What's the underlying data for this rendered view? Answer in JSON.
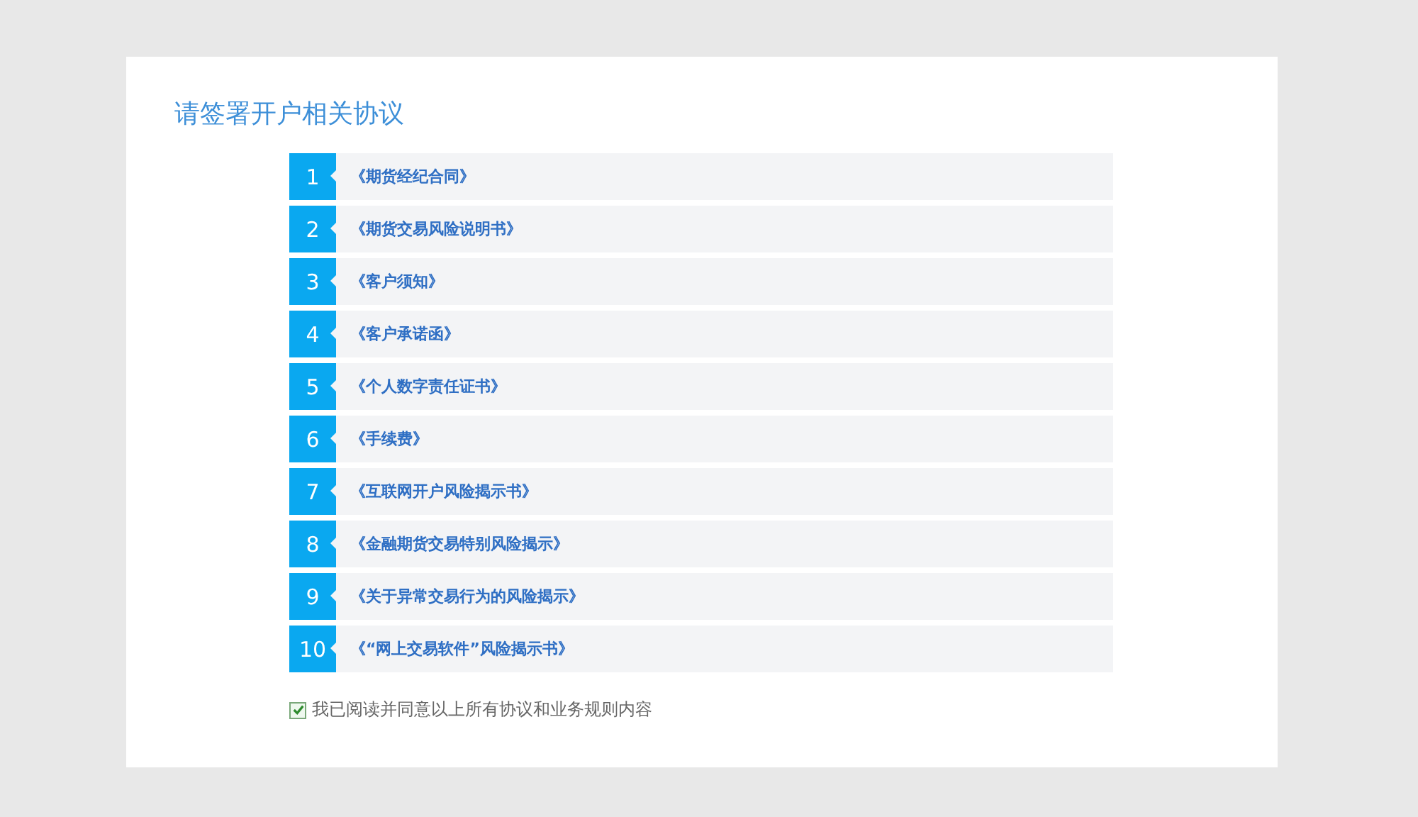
{
  "title": "请签署开户相关协议",
  "agreements": [
    {
      "number": "1",
      "name": "《期货经纪合同》"
    },
    {
      "number": "2",
      "name": "《期货交易风险说明书》"
    },
    {
      "number": "3",
      "name": "《客户须知》"
    },
    {
      "number": "4",
      "name": "《客户承诺函》"
    },
    {
      "number": "5",
      "name": "《个人数字责任证书》"
    },
    {
      "number": "6",
      "name": "《手续费》"
    },
    {
      "number": "7",
      "name": "《互联网开户风险揭示书》"
    },
    {
      "number": "8",
      "name": "《金融期货交易特别风险揭示》"
    },
    {
      "number": "9",
      "name": "《关于异常交易行为的风险揭示》"
    },
    {
      "number": "10",
      "name": "《“网上交易软件”风险揭示书》"
    }
  ],
  "consent": {
    "label": "我已阅读并同意以上所有协议和业务规则内容",
    "checked": true
  }
}
